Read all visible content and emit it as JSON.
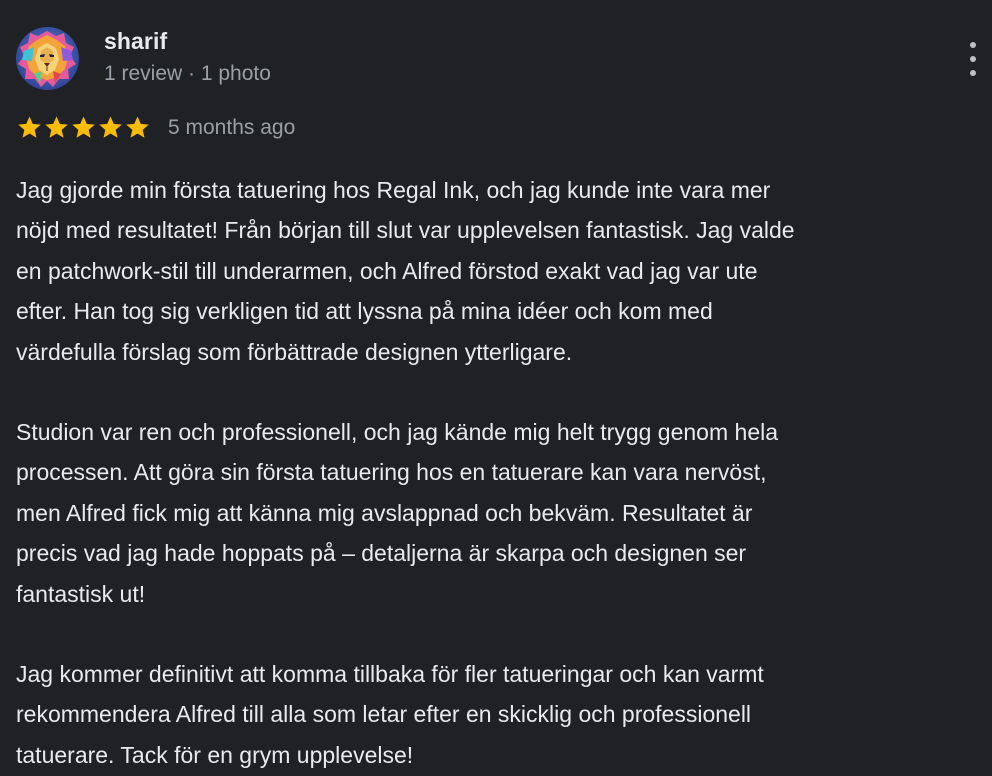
{
  "author": {
    "name": "sharif",
    "meta": "1 review · 1 photo",
    "avatar_icon": "lion-avatar"
  },
  "menu": {
    "icon": "more-vert-icon"
  },
  "rating": {
    "stars": 5,
    "max": 5,
    "star_color": "#fbbc04",
    "date": "5 months ago"
  },
  "review": {
    "paragraphs": [
      "Jag gjorde min första tatuering hos Regal Ink, och jag kunde inte vara mer\nnöjd med resultatet! Från början till slut var upplevelsen fantastisk. Jag valde\nen patchwork-stil till underarmen, och Alfred förstod exakt vad jag var ute\nefter. Han tog sig verkligen tid att lyssna på mina idéer och kom med\nvärdefulla förslag som förbättrade designen ytterligare.",
      "Studion var ren och professionell, och jag kände mig helt trygg genom hela\nprocessen. Att göra sin första tatuering hos en tatuerare kan vara nervöst,\nmen Alfred fick mig att känna mig avslappnad och bekväm. Resultatet är\nprecis vad jag hade hoppats på – detaljerna är skarpa och designen ser\nfantastisk ut!",
      "Jag kommer definitivt att komma tillbaka för fler tatueringar och kan varmt\nrekommendera Alfred till alla som letar efter en skicklig och professionell\ntatuerare. Tack för en grym upplevelse!"
    ]
  },
  "colors": {
    "background": "#202124",
    "text": "#e8eaed",
    "secondary_text": "#9aa0a6"
  }
}
